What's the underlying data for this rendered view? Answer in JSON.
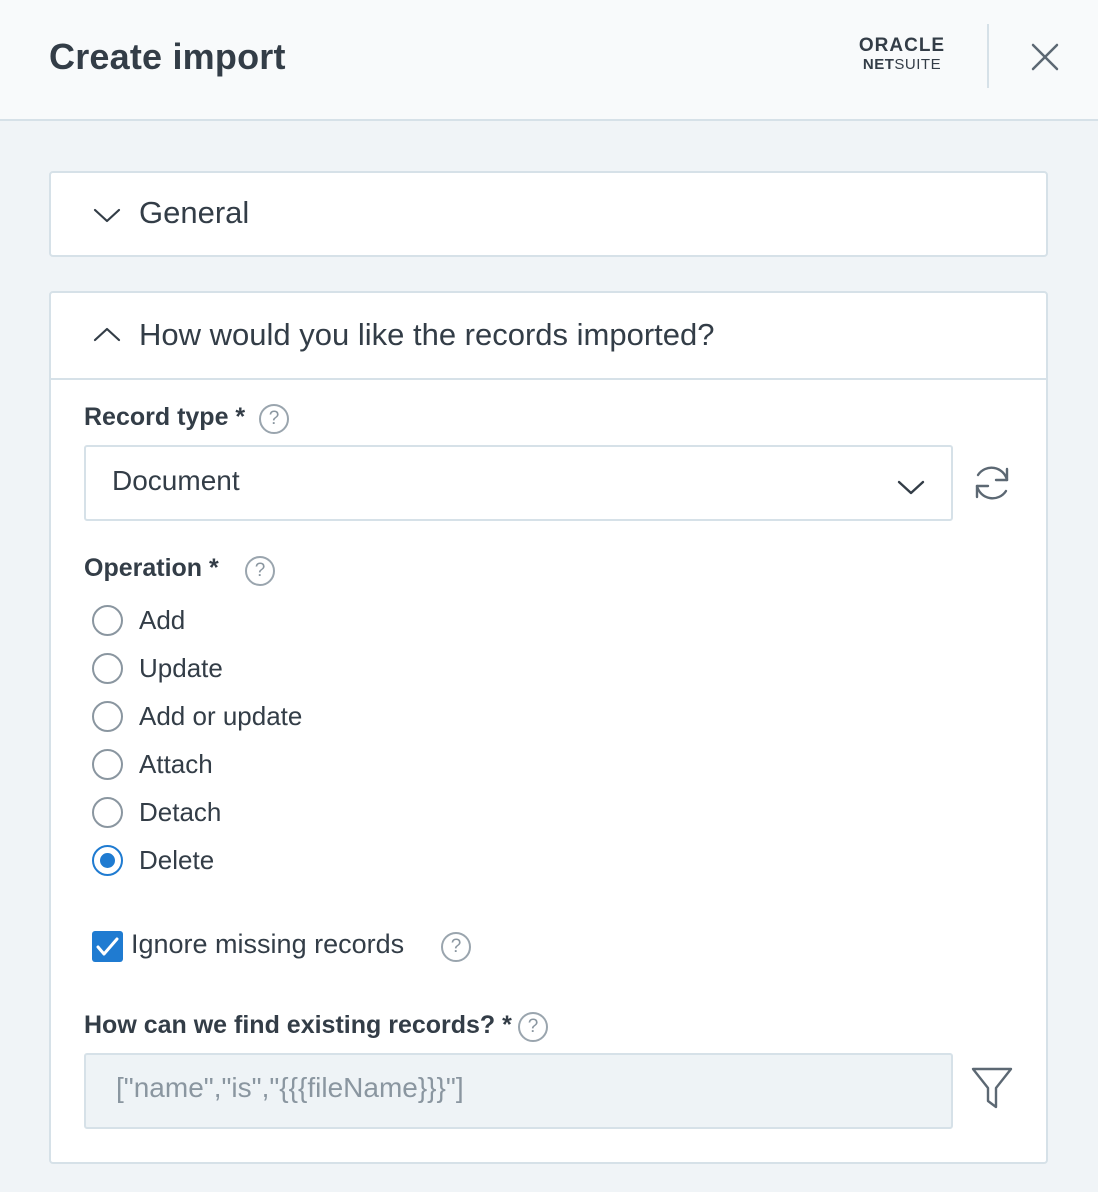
{
  "header": {
    "title": "Create import",
    "logo_top": "ORACLE",
    "logo_net": "NET",
    "logo_suite": "SUITE"
  },
  "general": {
    "title": "General"
  },
  "how": {
    "title": "How would you like the records imported?",
    "record_type_label": "Record type *",
    "record_type_value": "Document",
    "operation_label": "Operation *",
    "operations": [
      {
        "label": "Add",
        "checked": false
      },
      {
        "label": "Update",
        "checked": false
      },
      {
        "label": "Add or update",
        "checked": false
      },
      {
        "label": "Attach",
        "checked": false
      },
      {
        "label": "Detach",
        "checked": false
      },
      {
        "label": "Delete",
        "checked": true
      }
    ],
    "ignore_missing_label": "Ignore missing records",
    "ignore_missing_checked": true,
    "find_existing_label": "How can we find existing records? *",
    "find_existing_value": "[\"name\",\"is\",\"{{{fileName}}}\"]"
  },
  "icons": {
    "close": "close-icon",
    "chevron_down": "chevron-down-icon",
    "chevron_up": "chevron-up-icon",
    "help": "help-icon",
    "refresh": "refresh-icon",
    "filter": "filter-icon",
    "check": "check-icon"
  },
  "colors": {
    "accent": "#1f7bd1",
    "border": "#d6e1e8",
    "text": "#333d47",
    "muted": "#8a96a0",
    "background": "#f0f4f7"
  },
  "help_glyph": "?"
}
